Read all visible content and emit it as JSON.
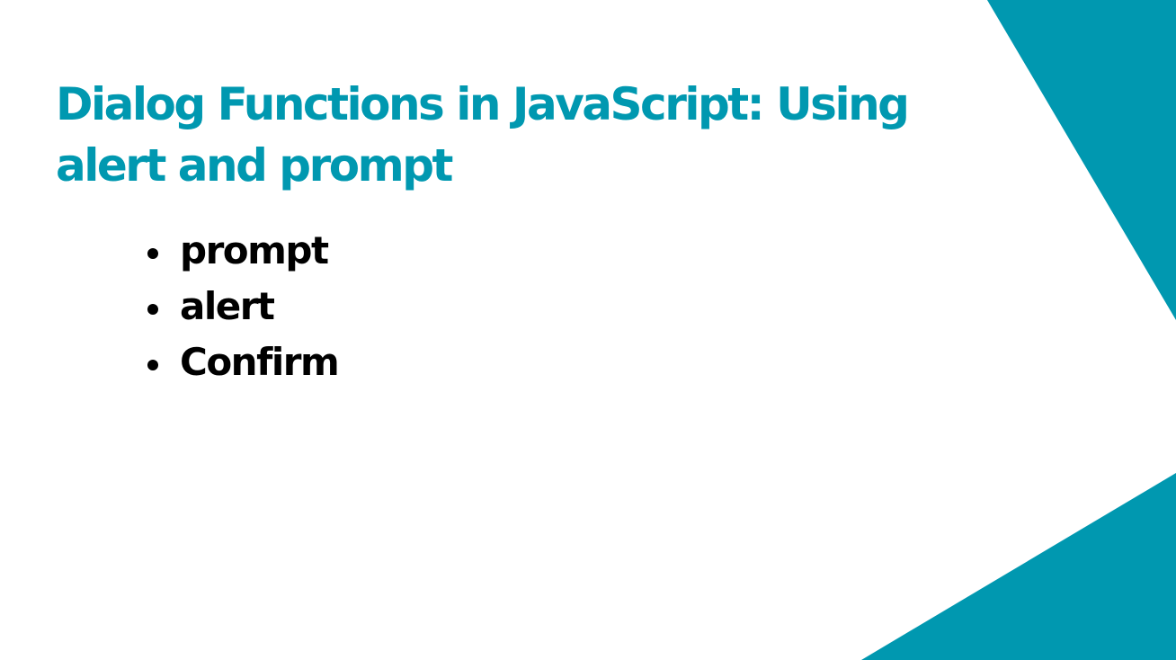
{
  "slide": {
    "title_line1": "Dialog Functions in JavaScript: Using",
    "title_line2": "alert and prompt",
    "bullets": [
      "prompt",
      "alert",
      "Confirm"
    ]
  },
  "colors": {
    "accent": "#0098b0",
    "text": "#000000",
    "background": "#ffffff"
  }
}
